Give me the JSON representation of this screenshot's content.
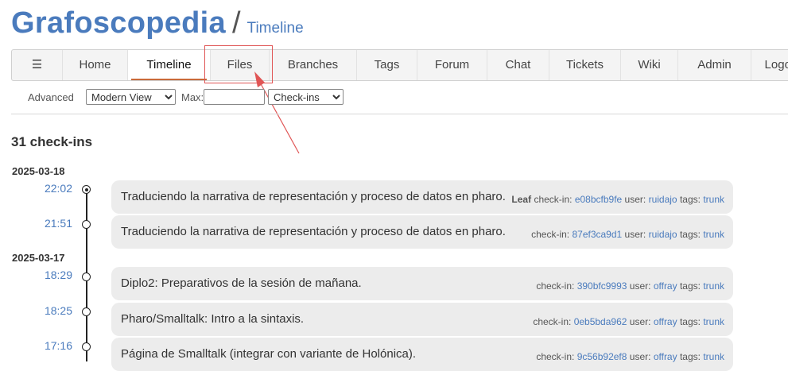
{
  "header": {
    "site_title": "Grafoscopedia",
    "separator": "/",
    "page_title": "Timeline"
  },
  "nav": {
    "hamburger": "☰",
    "items": [
      "Home",
      "Timeline",
      "Files",
      "Branches",
      "Tags",
      "Forum",
      "Chat",
      "Tickets",
      "Wiki",
      "Admin",
      "Logout"
    ],
    "active": "Timeline"
  },
  "submenu": {
    "advanced_label": "Advanced",
    "view_select": "Modern View",
    "max_label": "Max:",
    "max_value": "",
    "type_select": "Check-ins"
  },
  "count_text": "31 check-ins",
  "days": [
    {
      "date": "2025-03-18",
      "entries": [
        {
          "time": "22:02",
          "current": true,
          "message": "Traduciendo la narrativa de representación y proceso de datos en pharo.",
          "leaf": "Leaf",
          "checkin_label": "check-in:",
          "hash": "e08bcfb9fe",
          "user_label": "user:",
          "user": "ruidajo",
          "tags_label": "tags:",
          "tags": "trunk"
        },
        {
          "time": "21:51",
          "current": false,
          "message": "Traduciendo la narrativa de representación y proceso de datos en pharo.",
          "leaf": "",
          "checkin_label": "check-in:",
          "hash": "87ef3ca9d1",
          "user_label": "user:",
          "user": "ruidajo",
          "tags_label": "tags:",
          "tags": "trunk"
        }
      ]
    },
    {
      "date": "2025-03-17",
      "entries": [
        {
          "time": "18:29",
          "current": false,
          "message": "Diplo2: Preparativos de la sesión de mañana.",
          "leaf": "",
          "checkin_label": "check-in:",
          "hash": "390bfc9993",
          "user_label": "user:",
          "user": "offray",
          "tags_label": "tags:",
          "tags": "trunk"
        },
        {
          "time": "18:25",
          "current": false,
          "message": "Pharo/Smalltalk: Intro a la sintaxis.",
          "leaf": "",
          "checkin_label": "check-in:",
          "hash": "0eb5bda962",
          "user_label": "user:",
          "user": "offray",
          "tags_label": "tags:",
          "tags": "trunk"
        },
        {
          "time": "17:16",
          "current": false,
          "message": "Página de Smalltalk (integrar con variante de Holónica).",
          "leaf": "",
          "checkin_label": "check-in:",
          "hash": "9c56b92ef8",
          "user_label": "user:",
          "user": "offray",
          "tags_label": "tags:",
          "tags": "trunk"
        }
      ]
    }
  ],
  "colors": {
    "link": "#4a7bbd",
    "active_underline": "#c96a3a",
    "annotation": "#e05555"
  }
}
